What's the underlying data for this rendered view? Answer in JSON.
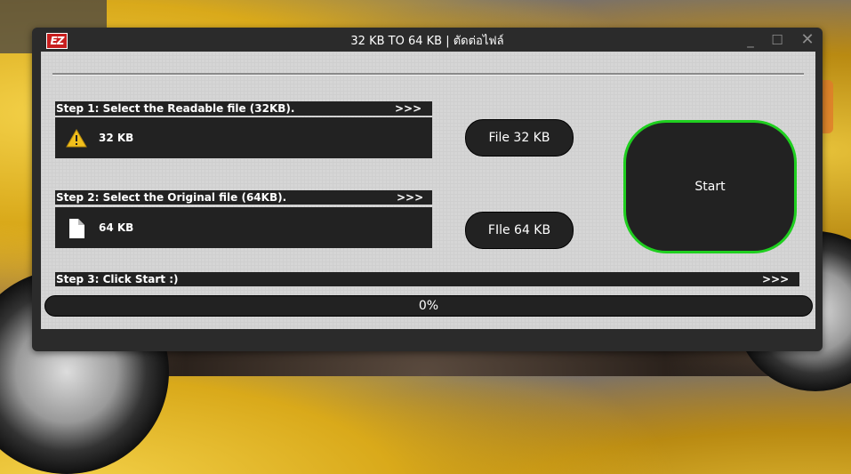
{
  "window": {
    "title": "32 KB TO 64 KB | ตัดต่อไฟล์",
    "logo": "EZ",
    "controls": {
      "minimize": "_",
      "maximize": "☐",
      "close": "✕"
    }
  },
  "steps": [
    {
      "label": "Step 1: Select the Readable file (32KB).",
      "arrows": ">>>"
    },
    {
      "label": "Step 2: Select the Original file (64KB).",
      "arrows": ">>>"
    },
    {
      "label": "Step 3: Click Start :)",
      "arrows": ">>>"
    }
  ],
  "files": [
    {
      "size": "32 KB",
      "icon": "warning-icon"
    },
    {
      "size": "64 KB",
      "icon": "file-icon"
    }
  ],
  "buttons": {
    "file32": "File 32 KB",
    "file64": "FIle 64 KB",
    "start": "Start"
  },
  "progress": {
    "value": 0,
    "text": "0%"
  },
  "colors": {
    "accent": "#1fcf1f",
    "panel": "#222222",
    "warning": "#f2c01c"
  }
}
